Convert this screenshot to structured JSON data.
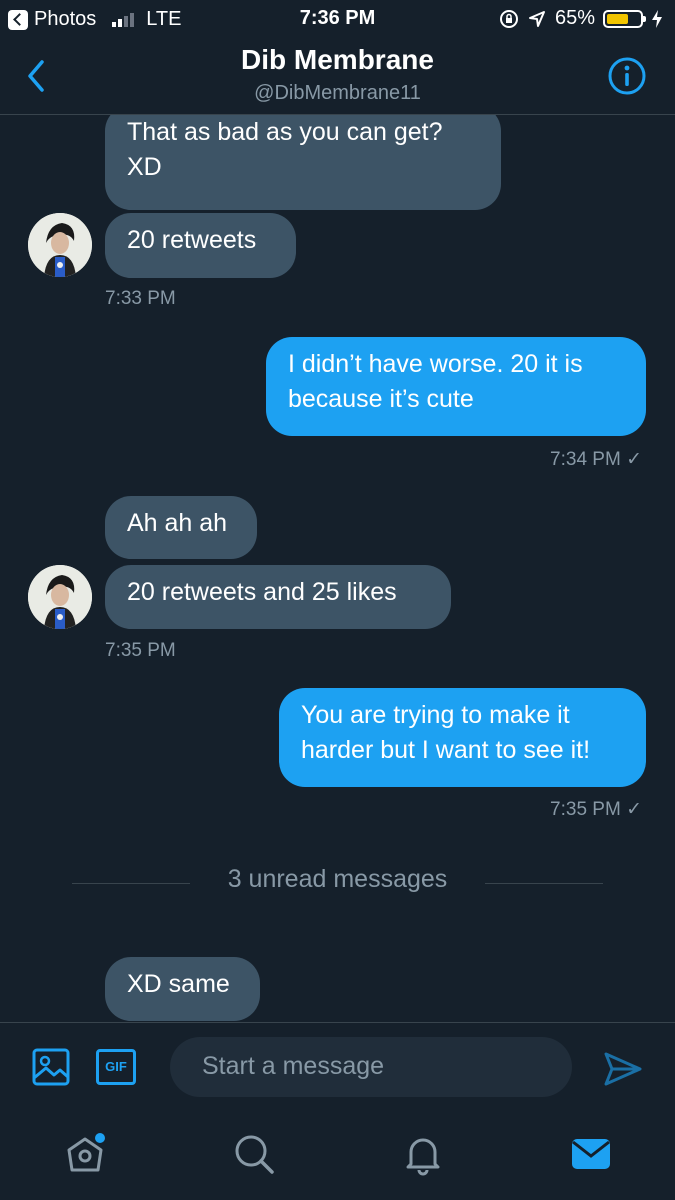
{
  "status_bar": {
    "back_app": "Photos",
    "carrier": "LTE",
    "time": "7:36 PM",
    "battery": "65%",
    "battery_level": 0.65
  },
  "header": {
    "name": "Dib Membrane",
    "handle": "@DibMembrane11"
  },
  "messages": [
    {
      "side": "in",
      "lines": [
        "That as bad as you can get?",
        "XD"
      ]
    },
    {
      "side": "in",
      "lines": [
        "20 retweets"
      ]
    },
    {
      "time": "7:33 PM"
    },
    {
      "side": "out",
      "lines": [
        "I didn’t have worse. 20 it is",
        "because it’s cute"
      ]
    },
    {
      "time": "7:34 PM ✓"
    },
    {
      "side": "in",
      "lines": [
        "Ah ah ah"
      ]
    },
    {
      "side": "in",
      "lines": [
        "20 retweets and 25 likes"
      ]
    },
    {
      "time": "7:35 PM"
    },
    {
      "side": "out",
      "lines": [
        "You are trying to make it",
        "harder but I want to see it!"
      ]
    },
    {
      "time": "7:35 PM ✓"
    },
    {
      "divider": "3 unread messages"
    },
    {
      "side": "in",
      "lines": [
        "XD same"
      ]
    }
  ],
  "chat": {
    "m1a": "That as bad as you can get?",
    "m1b": "XD",
    "m2": "20 retweets",
    "t1": "7:33 PM",
    "m3a": "I didn’t have worse. 20 it is",
    "m3b": "because it’s cute",
    "t2": "7:34 PM ✓",
    "m4": "Ah ah ah",
    "m5": "20 retweets and 25 likes",
    "t3": "7:35 PM",
    "m6a": "You are trying to make it",
    "m6b": "harder but I want to see it!",
    "t4": "7:35 PM ✓",
    "unread": "3 unread messages",
    "m7": "XD same"
  },
  "composer": {
    "placeholder": "Start a message",
    "gif_label": "GIF"
  },
  "tabs": [
    "home-icon",
    "search-icon",
    "notifications-icon",
    "messages-icon"
  ],
  "colors": {
    "background": "#15202b",
    "incoming_bubble": "#3d5466",
    "outgoing_bubble": "#1da1f2",
    "accent": "#1da1f2",
    "muted_text": "#8899a6"
  }
}
